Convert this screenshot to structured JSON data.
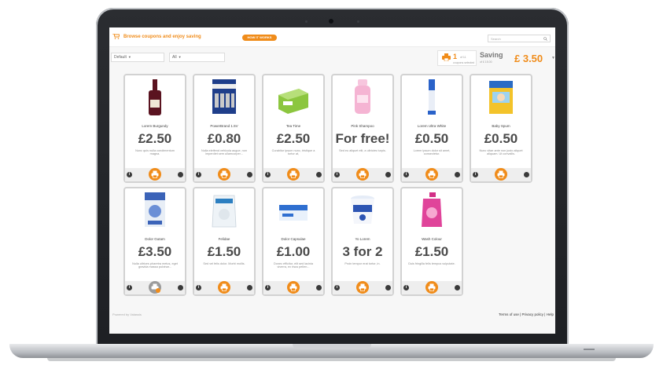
{
  "header": {
    "title": "Browse coupons and enjoy saving",
    "how_button": "HOW IT WORKS",
    "search_placeholder": "Search"
  },
  "filters": {
    "sort": "Default",
    "category": "All"
  },
  "print_status": {
    "count": "1",
    "of": "of 11",
    "label": "coupons selected"
  },
  "saving": {
    "label": "Saving",
    "sub": "of £ 15.00",
    "amount": "£ 3.50"
  },
  "coupons": [
    {
      "title": "Lorem Burgundy",
      "price": "£2.50",
      "desc": "Nunc quis nulla condimentum magna.",
      "image": "wine-bottle-icon"
    },
    {
      "title": "PowerBrand 1.5V",
      "price": "£0.80",
      "desc": "Nulla eleifend vehicula augue, non imperdiet sem ullamcorper...",
      "image": "batteries-icon"
    },
    {
      "title": "Tea Time",
      "price": "£2.50",
      "desc": "Curabitur ipsum nunc, tristique a tortor at,",
      "image": "tea-box-icon"
    },
    {
      "title": "Pink Shampoo",
      "price": "For free!",
      "desc": "Sed eu aliquet elit, a ultricies turpis.",
      "image": "shampoo-bottle-icon"
    },
    {
      "title": "Lorem Ultra White",
      "price": "£0.50",
      "desc": "Lorem ipsum dolor sit amet, consectetur.",
      "image": "toothpaste-icon"
    },
    {
      "title": "Baby Spum",
      "price": "£0.50",
      "desc": "Nunc vitae ante non justo aliquet aliquam. Ut convallis.",
      "image": "baby-box-icon"
    },
    {
      "title": "Dolor Gutam",
      "price": "£3.50",
      "desc": "Nulla ultrices pharetra metus, eget gravida massa pulvinar...",
      "image": "cereal-box-icon"
    },
    {
      "title": "Felidae",
      "price": "£1.50",
      "desc": "Sed vel felis dolor. Morbi mollis.",
      "image": "cat-litter-bag-icon"
    },
    {
      "title": "Dolor Capsulae",
      "price": "£1.00",
      "desc": "Donec efficitur, elit sed lacinia viverra, ex risus pellen...",
      "image": "capsules-box-icon"
    },
    {
      "title": "Yo Lorem",
      "price": "3 for 2",
      "desc": "Proin tempor erat tortor, in.",
      "image": "yogurt-cup-icon"
    },
    {
      "title": "Wash Colour",
      "price": "£1.50",
      "desc": "Duis fringilla felis tempus vulputate.",
      "image": "detergent-bottle-icon"
    }
  ],
  "footer": {
    "powered": "Powered by Valassis",
    "links": "Terms of use | Privacy policy | Help"
  }
}
